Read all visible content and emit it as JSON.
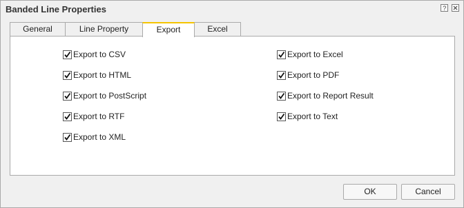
{
  "dialog": {
    "title": "Banded Line Properties",
    "help_icon": "help-icon",
    "close_icon": "close-icon"
  },
  "tabs": [
    {
      "label": "General",
      "active": false
    },
    {
      "label": "Line Property",
      "active": false
    },
    {
      "label": "Export",
      "active": true
    },
    {
      "label": "Excel",
      "active": false
    }
  ],
  "export_options": {
    "left": [
      {
        "label": "Export to CSV",
        "checked": true
      },
      {
        "label": "Export to HTML",
        "checked": true
      },
      {
        "label": "Export to PostScript",
        "checked": true
      },
      {
        "label": "Export to RTF",
        "checked": true
      },
      {
        "label": "Export to XML",
        "checked": true
      }
    ],
    "right": [
      {
        "label": "Export to Excel",
        "checked": true
      },
      {
        "label": "Export to PDF",
        "checked": true
      },
      {
        "label": "Export to Report Result",
        "checked": true
      },
      {
        "label": "Export to Text",
        "checked": true
      }
    ]
  },
  "buttons": {
    "ok_label": "OK",
    "cancel_label": "Cancel"
  },
  "colors": {
    "active_tab_accent": "#f5c400",
    "dialog_bg": "#f0f0f0",
    "border": "#a9a9a9"
  }
}
